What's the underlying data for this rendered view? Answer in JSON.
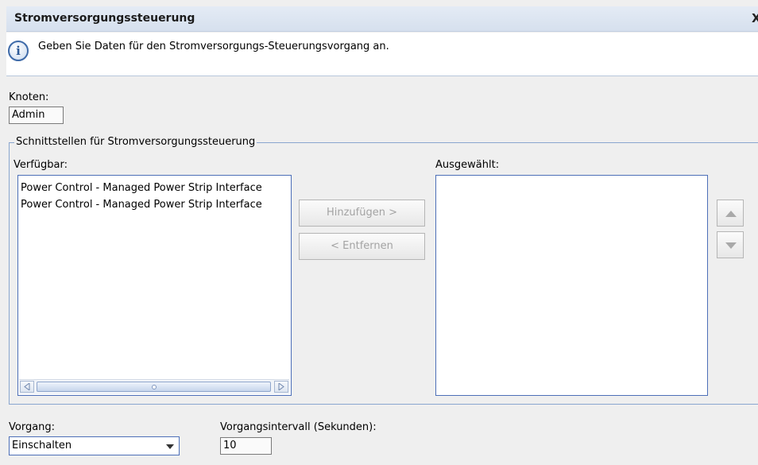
{
  "window": {
    "title": "Stromversorgungssteuerung",
    "close_label": "X"
  },
  "info": {
    "icon": "info-icon",
    "icon_glyph": "i",
    "message": "Geben Sie Daten für den Stromversorgungs-Steuerungsvorgang an."
  },
  "node": {
    "label": "Knoten:",
    "value": "Admin"
  },
  "interfaces": {
    "group_label": "Schnittstellen für Stromversorgungssteuerung",
    "available_label": "Verfügbar:",
    "selected_label": "Ausgewählt:",
    "available_items": [
      "Power Control - Managed Power Strip Interface",
      "Power Control - Managed Power Strip Interface"
    ],
    "selected_items": [],
    "add_label": "Hinzufügen  >",
    "remove_label": "<  Entfernen",
    "move_up_icon": "arrow-up-icon",
    "move_down_icon": "arrow-down-icon"
  },
  "operation": {
    "label": "Vorgang:",
    "selected": "Einschalten"
  },
  "interval": {
    "label": "Vorgangsintervall (Sekunden):",
    "value": "10"
  },
  "colors": {
    "accent_border": "#4d6fb8",
    "title_background": "#dbe4f1",
    "disabled_text": "#a3a3a3"
  }
}
